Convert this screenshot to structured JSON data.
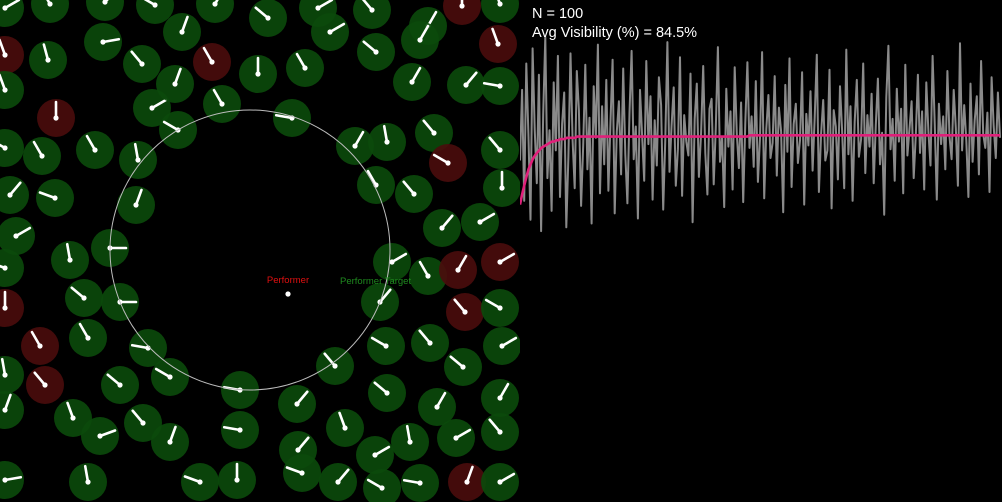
{
  "stats": {
    "population_text": "N = 100",
    "visibility_text": "Avg Visibility (%) = 84.5%"
  },
  "scene": {
    "performer_label": "Performer",
    "target_label": "Performer Target",
    "colors": {
      "background": "#000000",
      "agent_visible": "#0b4a0b",
      "agent_blocked": "#4a0c0c",
      "performer_text": "#e01010",
      "target_text": "#1f8a1f",
      "ring": "#bdbdbd",
      "heading": "#ffffff"
    }
  },
  "chart_data": {
    "type": "line",
    "title": "",
    "xlabel": "",
    "ylabel": "",
    "ylim": [
      0,
      100
    ],
    "series": [
      {
        "color": "#8a8a8a",
        "values": [
          82.5,
          88.1,
          79.3,
          90.2,
          84.6,
          77.8,
          91.4,
          85.0,
          80.7,
          89.3,
          76.9,
          86.2,
          92.3,
          81.1,
          84.9,
          78.5,
          88.7,
          83.3,
          90.8,
          79.6,
          85.4,
          87.9,
          77.2,
          82.8,
          91.0,
          84.1,
          80.3,
          89.6,
          86.5,
          78.9,
          83.7,
          90.1,
          81.8,
          85.9,
          77.5,
          88.4,
          84.3,
          91.7,
          79.9,
          86.8,
          82.2,
          88.9,
          80.1,
          85.6,
          90.5,
          78.3,
          84.8,
          87.2,
          81.4,
          89.8,
          83.0,
          79.1,
          86.3,
          91.2,
          82.6,
          85.2,
          77.9,
          88.1,
          84.5,
          80.9,
          90.4,
          83.8,
          87.6,
          79.4,
          85.7,
          82.1,
          89.1,
          86.9,
          78.6,
          84.2,
          91.9,
          81.6,
          85.3,
          88.3,
          80.5,
          83.4,
          90.7,
          79.7,
          86.1,
          84.0,
          82.9,
          89.4,
          77.6,
          85.8,
          88.6,
          81.2,
          84.7,
          90.0,
          83.1,
          79.8,
          86.6,
          87.4,
          80.6,
          85.1,
          91.5,
          82.4,
          84.4,
          78.8,
          88.2,
          83.6,
          86.4,
          80.2,
          89.9,
          84.6,
          81.9,
          87.1,
          79.2,
          85.5,
          90.3,
          83.5,
          86.0,
          82.0,
          88.8,
          80.8,
          84.3,
          91.1,
          79.5,
          85.0,
          87.7,
          82.7,
          83.9,
          89.2,
          81.3,
          86.7,
          84.8,
          78.4,
          88.5,
          83.2,
          90.6,
          80.4,
          85.4,
          87.0,
          82.3,
          84.1,
          89.5,
          79.0,
          86.2,
          83.7,
          88.0,
          81.7,
          85.9,
          90.9,
          80.0,
          84.6,
          87.3,
          82.5,
          83.3,
          89.7,
          78.7,
          86.5,
          85.2,
          81.0,
          88.4,
          84.9,
          80.3,
          91.3,
          83.0,
          86.8,
          79.3,
          85.6,
          88.9,
          82.8,
          84.2,
          90.2,
          81.5,
          86.1,
          83.6,
          87.8,
          80.7,
          85.3,
          89.0,
          82.2,
          84.7,
          78.2,
          87.5,
          91.6,
          83.4,
          85.8,
          80.9,
          88.2,
          84.0,
          86.6,
          79.9,
          90.1,
          82.9,
          85.0,
          87.2,
          81.1,
          84.5,
          89.3,
          83.1,
          86.4,
          80.2,
          88.7,
          84.8,
          82.1,
          90.8,
          85.5,
          79.4,
          87.0,
          83.8,
          86.0,
          81.8,
          89.6,
          84.4,
          82.6,
          88.1,
          85.1,
          80.5,
          91.8,
          83.3,
          86.9,
          84.1,
          79.6,
          88.6,
          82.4,
          85.7,
          87.6,
          81.4,
          90.4,
          84.6,
          83.5,
          86.3,
          80.0,
          89.1,
          85.2,
          82.7,
          87.9,
          84.3
        ]
      },
      {
        "color": "#e0207a",
        "values": [
          79.0,
          79.8,
          80.5,
          81.2,
          81.8,
          82.2,
          82.6,
          82.9,
          83.1,
          83.3,
          83.5,
          83.6,
          83.7,
          83.8,
          83.9,
          84.0,
          84.0,
          84.1,
          84.1,
          84.2,
          84.2,
          84.2,
          84.3,
          84.3,
          84.3,
          84.3,
          84.3,
          84.4,
          84.4,
          84.4,
          84.4,
          84.4,
          84.4,
          84.4,
          84.4,
          84.4,
          84.4,
          84.4,
          84.4,
          84.4,
          84.4,
          84.4,
          84.4,
          84.4,
          84.4,
          84.4,
          84.4,
          84.4,
          84.4,
          84.4,
          84.4,
          84.4,
          84.4,
          84.4,
          84.4,
          84.4,
          84.4,
          84.4,
          84.4,
          84.4,
          84.4,
          84.4,
          84.4,
          84.4,
          84.4,
          84.4,
          84.4,
          84.4,
          84.4,
          84.4,
          84.4,
          84.4,
          84.4,
          84.4,
          84.4,
          84.4,
          84.4,
          84.4,
          84.4,
          84.4,
          84.4,
          84.4,
          84.4,
          84.4,
          84.4,
          84.4,
          84.4,
          84.4,
          84.4,
          84.4,
          84.4,
          84.4,
          84.4,
          84.4,
          84.4,
          84.4,
          84.4,
          84.4,
          84.4,
          84.4,
          84.4,
          84.4,
          84.4,
          84.4,
          84.4,
          84.4,
          84.4,
          84.4,
          84.5,
          84.5,
          84.5,
          84.5,
          84.5,
          84.5,
          84.5,
          84.5,
          84.5,
          84.5,
          84.5,
          84.5,
          84.5,
          84.5,
          84.5,
          84.5,
          84.5,
          84.5,
          84.5,
          84.5,
          84.5,
          84.5,
          84.5,
          84.5,
          84.5,
          84.5,
          84.5,
          84.5,
          84.5,
          84.5,
          84.5,
          84.5,
          84.5,
          84.5,
          84.5,
          84.5,
          84.5,
          84.5,
          84.5,
          84.5,
          84.5,
          84.5,
          84.5,
          84.5,
          84.5,
          84.5,
          84.5,
          84.5,
          84.5,
          84.5,
          84.5,
          84.5,
          84.5,
          84.5,
          84.5,
          84.5,
          84.5,
          84.5,
          84.5,
          84.5,
          84.5,
          84.5,
          84.5,
          84.5,
          84.5,
          84.5,
          84.5,
          84.5,
          84.5,
          84.5,
          84.5,
          84.5,
          84.5,
          84.5,
          84.5,
          84.5,
          84.5,
          84.5,
          84.5,
          84.5,
          84.5,
          84.5,
          84.5,
          84.5,
          84.5,
          84.5,
          84.5,
          84.5,
          84.5,
          84.5,
          84.5,
          84.5,
          84.5,
          84.5,
          84.5,
          84.5,
          84.5,
          84.5,
          84.5,
          84.5,
          84.5,
          84.5,
          84.5,
          84.5,
          84.5,
          84.5,
          84.5,
          84.5,
          84.5,
          84.5,
          84.5,
          84.5,
          84.5,
          84.5,
          84.5,
          84.5,
          84.5,
          84.5,
          84.5
        ]
      }
    ]
  }
}
